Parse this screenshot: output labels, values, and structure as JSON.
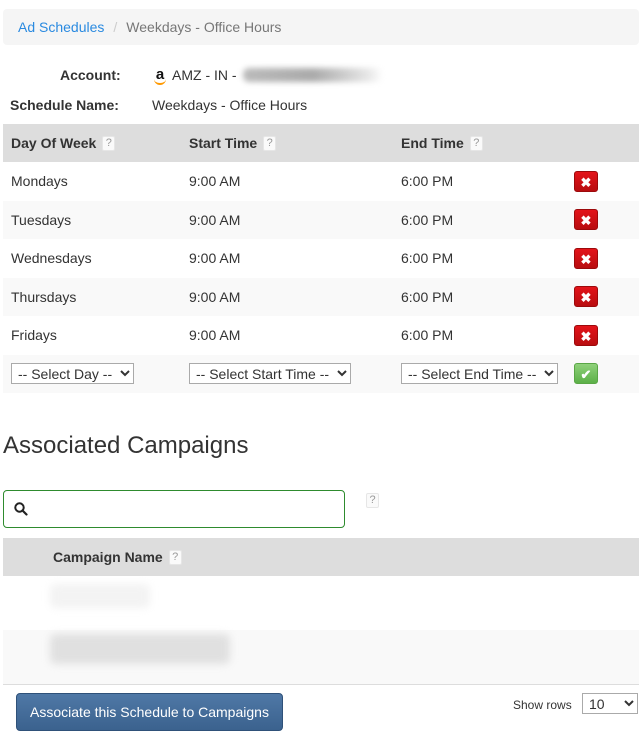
{
  "breadcrumb": {
    "parent": "Ad Schedules",
    "separator": "/",
    "current": "Weekdays - Office Hours"
  },
  "info": {
    "account_label": "Account:",
    "account_icon": "amazon-logo",
    "account_value": "AMZ - IN -",
    "schedule_label": "Schedule Name:",
    "schedule_value": "Weekdays - Office Hours"
  },
  "schedule_table": {
    "headers": {
      "day": "Day Of Week",
      "start": "Start Time",
      "end": "End Time",
      "help": "?"
    },
    "rows": [
      {
        "day": "Mondays",
        "start": "9:00 AM",
        "end": "6:00 PM",
        "action": "✖"
      },
      {
        "day": "Tuesdays",
        "start": "9:00 AM",
        "end": "6:00 PM",
        "action": "✖"
      },
      {
        "day": "Wednesdays",
        "start": "9:00 AM",
        "end": "6:00 PM",
        "action": "✖"
      },
      {
        "day": "Thursdays",
        "start": "9:00 AM",
        "end": "6:00 PM",
        "action": "✖"
      },
      {
        "day": "Fridays",
        "start": "9:00 AM",
        "end": "6:00 PM",
        "action": "✖"
      }
    ],
    "new_row": {
      "day_select": "-- Select Day --",
      "start_select": "-- Select Start Time --",
      "end_select": "-- Select End Time --",
      "confirm": "✔"
    }
  },
  "campaigns": {
    "title": "Associated Campaigns",
    "search_placeholder": "",
    "search_help": "?",
    "column_header": "Campaign Name",
    "column_help": "?",
    "associate_button": "Associate this Schedule to Campaigns",
    "show_rows_label": "Show rows",
    "show_rows_value": "10"
  }
}
